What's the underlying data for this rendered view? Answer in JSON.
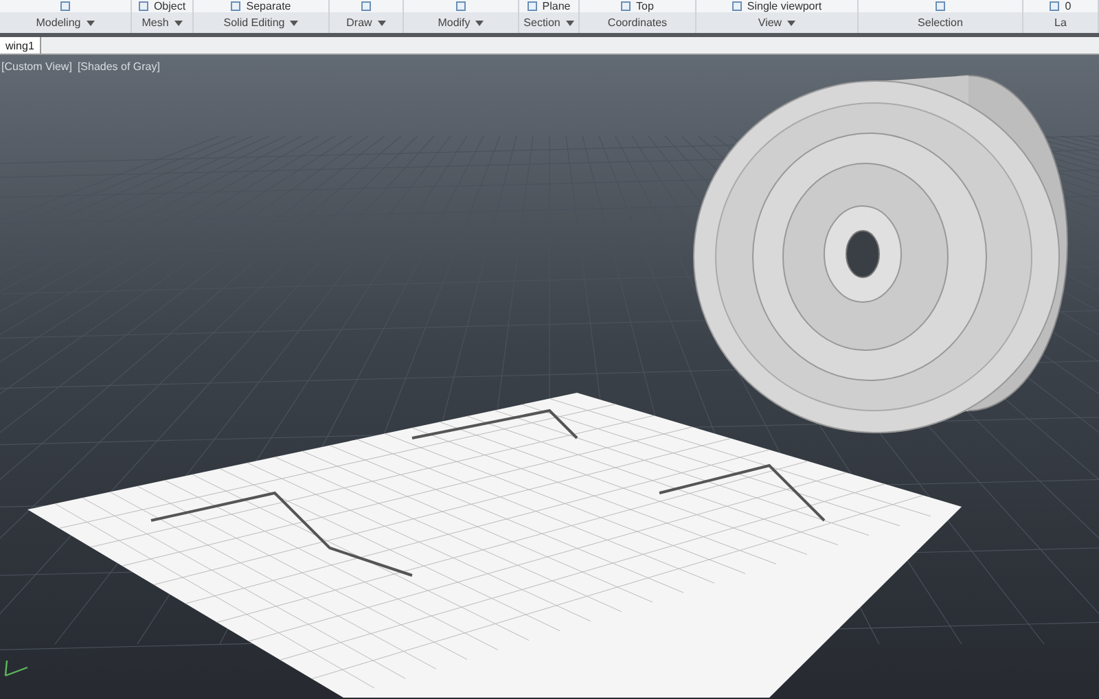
{
  "ribbon": {
    "panels": [
      {
        "label": "Modeling",
        "has_menu": true
      },
      {
        "label": "Mesh",
        "has_menu": true,
        "button_text": "Object"
      },
      {
        "label": "Solid Editing",
        "has_menu": true,
        "button_text": "Separate"
      },
      {
        "label": "Draw",
        "has_menu": true
      },
      {
        "label": "Modify",
        "has_menu": true
      },
      {
        "label": "Section",
        "has_menu": true,
        "button_text": "Plane"
      },
      {
        "label": "Coordinates",
        "has_menu": false,
        "button_text": "Top"
      },
      {
        "label": "View",
        "has_menu": true,
        "button_text": "Single viewport"
      },
      {
        "label": "Selection",
        "has_menu": false
      },
      {
        "label": "La",
        "has_menu": false,
        "button_text": "0"
      }
    ]
  },
  "document_tab": {
    "label": "wing1"
  },
  "viewport": {
    "view_label": "[Custom View]",
    "style_label": "[Shades of Gray]"
  }
}
